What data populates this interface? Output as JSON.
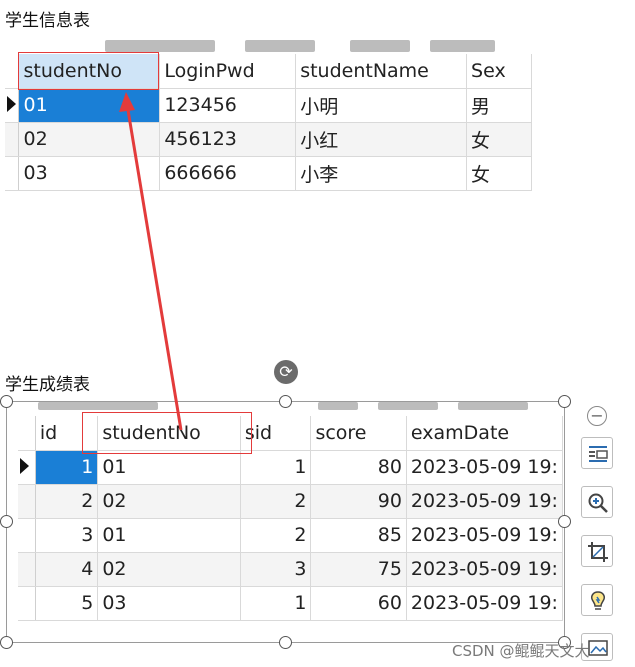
{
  "student_table": {
    "caption": "学生信息表",
    "columns": [
      "studentNo",
      "LoginPwd",
      "studentName",
      "Sex"
    ],
    "rows": [
      [
        "01",
        "123456",
        "小明",
        "男"
      ],
      [
        "02",
        "456123",
        "小红",
        "女"
      ],
      [
        "03",
        "666666",
        "小李",
        "女"
      ]
    ]
  },
  "score_table": {
    "caption": "学生成绩表",
    "columns": [
      "id",
      "studentNo",
      "sid",
      "score",
      "examDate"
    ],
    "rows": [
      [
        "1",
        "01",
        "1",
        "80",
        "2023-05-09 19:"
      ],
      [
        "2",
        "02",
        "2",
        "90",
        "2023-05-09 19:"
      ],
      [
        "3",
        "01",
        "2",
        "85",
        "2023-05-09 19:"
      ],
      [
        "4",
        "02",
        "3",
        "75",
        "2023-05-09 19:"
      ],
      [
        "5",
        "03",
        "1",
        "60",
        "2023-05-09 19:"
      ]
    ]
  },
  "icons": {
    "rotate": "rotate-icon",
    "collapse": "minus-icon",
    "layout_options": "layout-options-icon",
    "zoom": "zoom-in-icon",
    "crop": "crop-icon",
    "ideas": "lightbulb-icon",
    "alt_text": "alt-text-icon"
  },
  "annotation_color": "#e33b3b",
  "selection_color": "#1a7fd6",
  "watermark": "CSDN @鲲鲲天文大"
}
